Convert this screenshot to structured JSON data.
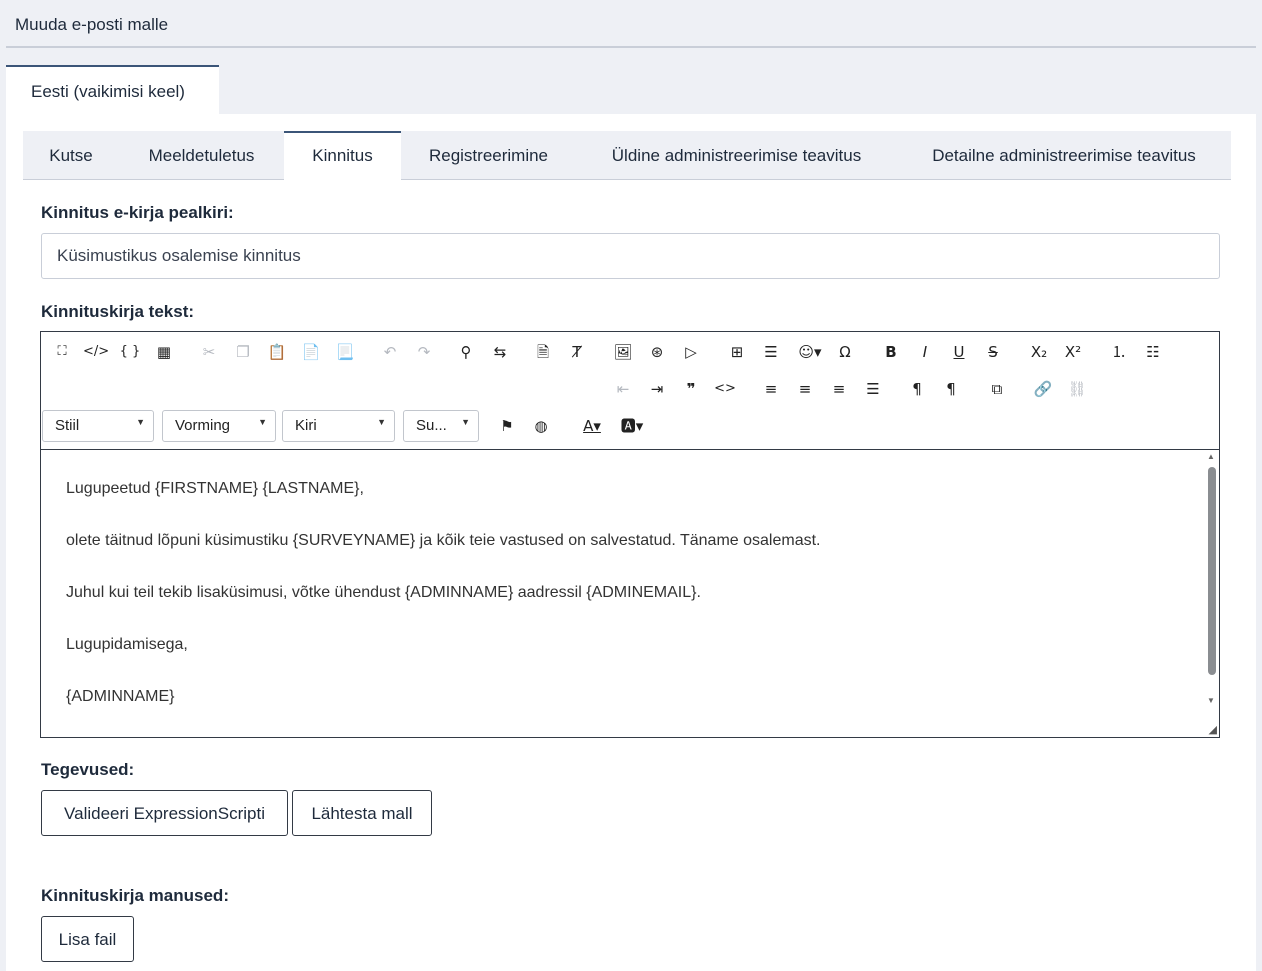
{
  "header": {
    "title": "Muuda e-posti malle"
  },
  "language_tab": {
    "label": "Eesti (vaikimisi keel)"
  },
  "template_tabs": [
    {
      "label": "Kutse"
    },
    {
      "label": "Meeldetuletus"
    },
    {
      "label": "Kinnitus",
      "active": true
    },
    {
      "label": "Registreerimine"
    },
    {
      "label": "Üldine administreerimise teavitus"
    },
    {
      "label": "Detailne administreerimise teavitus"
    }
  ],
  "subject": {
    "label": "Kinnitus e-kirja pealkiri:",
    "value": "Küsimustikus osalemise kinnitus"
  },
  "body": {
    "label": "Kinnituskirja tekst:",
    "paragraphs": [
      "Lugupeetud {FIRSTNAME} {LASTNAME},",
      "olete täitnud lõpuni küsimustiku {SURVEYNAME} ja kõik teie vastused on salvestatud. Täname osalemast.",
      "Juhul kui teil tekib lisaküsimusi, võtke ühendust {ADMINNAME} aadressil {ADMINEMAIL}.",
      "Lugupidamisega,",
      "{ADMINNAME}"
    ]
  },
  "editor_toolbar": {
    "combos": {
      "style": "Stiil",
      "format": "Vorming",
      "font": "Kiri",
      "size": "Su..."
    }
  },
  "actions": {
    "label": "Tegevused:",
    "validate": "Valideeri ExpressionScripti",
    "reset": "Lähtesta mall"
  },
  "attachments": {
    "label": "Kinnituskirja manused:",
    "add_file": "Lisa fail"
  }
}
